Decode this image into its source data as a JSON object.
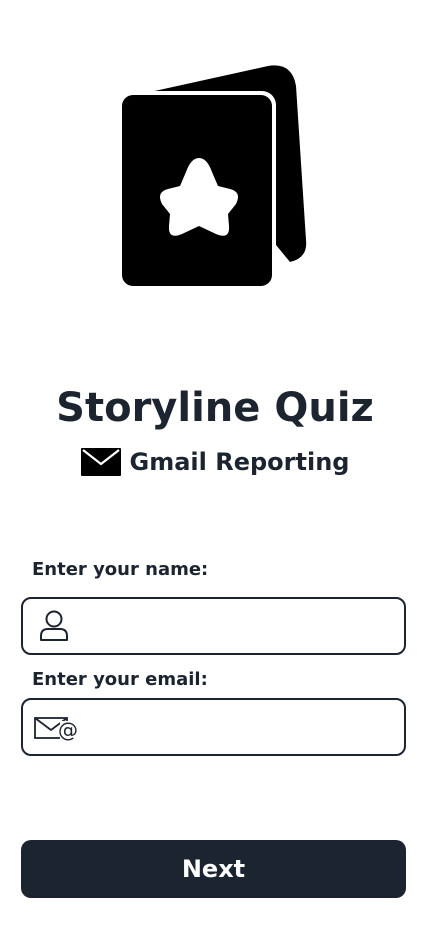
{
  "brand": {
    "logo_icon": "star-card-deck-icon",
    "title": "Storyline Quiz",
    "subtitle_icon": "envelope-icon",
    "subtitle": "Gmail Reporting"
  },
  "form": {
    "name_label": "Enter your name:",
    "name_value": "",
    "name_icon": "user-icon",
    "email_label": "Enter your email:",
    "email_value": "",
    "email_icon": "mail-at-icon"
  },
  "actions": {
    "next_label": "Next"
  },
  "colors": {
    "primary": "#1c2430",
    "background": "#ffffff",
    "button_text": "#ffffff"
  }
}
